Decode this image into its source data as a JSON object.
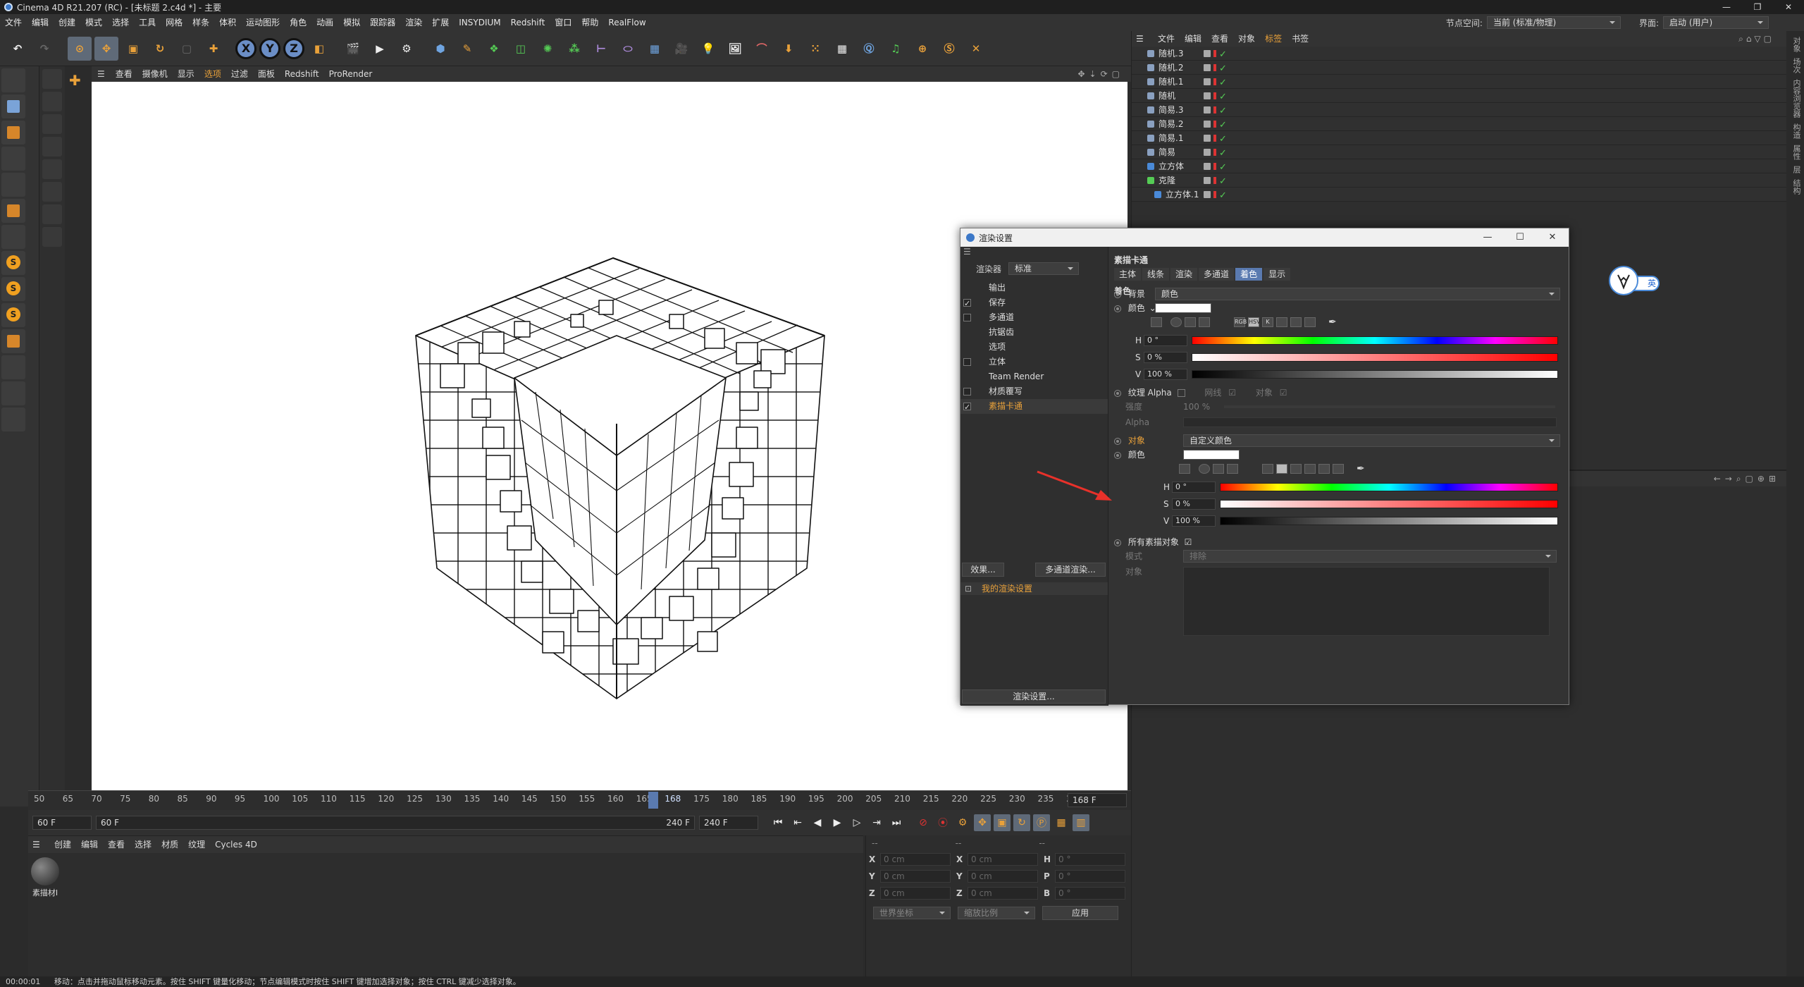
{
  "window": {
    "title": "Cinema 4D R21.207 (RC) - [未标题 2.c4d *] - 主要",
    "controls": [
      "—",
      "❐",
      "✕"
    ]
  },
  "menubar": {
    "items": [
      "文件",
      "编辑",
      "创建",
      "模式",
      "选择",
      "工具",
      "网格",
      "样条",
      "体积",
      "运动图形",
      "角色",
      "动画",
      "模拟",
      "跟踪器",
      "渲染",
      "扩展",
      "INSYDIUM",
      "Redshift",
      "窗口",
      "帮助",
      "RealFlow"
    ],
    "node_space_label": "节点空间:",
    "node_space_value": "当前 (标准/物理)",
    "layout_label": "界面:",
    "layout_value": "启动 (用户)"
  },
  "toolbar": {
    "axis_labels": [
      "X",
      "Y",
      "Z"
    ]
  },
  "viewport": {
    "menu": [
      "查看",
      "摄像机",
      "显示",
      "选项",
      "过滤",
      "面板",
      "Redshift",
      "ProRender"
    ],
    "active_menu": "选项"
  },
  "timeline": {
    "ticks": [
      "50",
      "65",
      "70",
      "75",
      "80",
      "85",
      "90",
      "95",
      "100",
      "105",
      "110",
      "115",
      "120",
      "125",
      "130",
      "135",
      "140",
      "145",
      "150",
      "155",
      "160",
      "165",
      "168",
      "175",
      "180",
      "185",
      "190",
      "195",
      "200",
      "205",
      "210",
      "215",
      "220",
      "225",
      "230",
      "235",
      "240"
    ],
    "current_frame": "168 F",
    "start_field": "60 F",
    "start_field2": "60 F",
    "end_field": "240 F",
    "end_field2": "240 F"
  },
  "material_panel": {
    "menu": [
      "创建",
      "编辑",
      "查看",
      "选择",
      "材质",
      "纹理",
      "Cycles 4D"
    ],
    "material_name": "素描材I"
  },
  "coords": {
    "header_left": "--",
    "header_mid": "--",
    "header_right": "--",
    "rows": [
      {
        "a": "X",
        "av": "0 cm",
        "b": "X",
        "bv": "0 cm",
        "c": "H",
        "cv": "0 °"
      },
      {
        "a": "Y",
        "av": "0 cm",
        "b": "Y",
        "bv": "0 cm",
        "c": "P",
        "cv": "0 °"
      },
      {
        "a": "Z",
        "av": "0 cm",
        "b": "Z",
        "bv": "0 cm",
        "c": "B",
        "cv": "0 °"
      }
    ],
    "world_coords": "世界坐标",
    "scale_ratio": "缩放比例",
    "apply": "应用"
  },
  "status": {
    "time": "00:00:01",
    "message": "移动：点击并拖动鼠标移动元素。按住 SHIFT 键量化移动；节点编辑模式时按住 SHIFT 键增加选择对象；按住 CTRL 键减少选择对象。"
  },
  "object_manager": {
    "menu": [
      "文件",
      "编辑",
      "查看",
      "对象",
      "标签",
      "书签"
    ],
    "active_menu": "标签",
    "objects": [
      {
        "name": "随机.3"
      },
      {
        "name": "随机.2"
      },
      {
        "name": "随机.1"
      },
      {
        "name": "随机"
      },
      {
        "name": "简易.3"
      },
      {
        "name": "简易.2"
      },
      {
        "name": "简易.1"
      },
      {
        "name": "简易"
      },
      {
        "name": "立方体"
      },
      {
        "name": "克隆"
      },
      {
        "name": "立方体.1"
      }
    ]
  },
  "right_strip": [
    "对象",
    "场次",
    "内容浏览器",
    "构造",
    "属性",
    "层",
    "结构"
  ],
  "render_dialog": {
    "title": "渲染设置",
    "renderer_label": "渲染器",
    "renderer_value": "标准",
    "items": [
      {
        "label": "输出",
        "check": "none"
      },
      {
        "label": "保存",
        "check": "on"
      },
      {
        "label": "多通道",
        "check": "off"
      },
      {
        "label": "抗锯齿",
        "check": "none"
      },
      {
        "label": "选项",
        "check": "none"
      },
      {
        "label": "立体",
        "check": "off"
      },
      {
        "label": "Team Render",
        "check": "none"
      },
      {
        "label": "材质覆写",
        "check": "off"
      },
      {
        "label": "素描卡通",
        "check": "on"
      }
    ],
    "effects_button": "效果...",
    "multipass_button": "多通道渲染...",
    "preset": "我的渲染设置",
    "render_settings_button": "渲染设置...",
    "section_title": "素描卡通",
    "tabs": [
      "主体",
      "线条",
      "渲染",
      "多通道",
      "着色",
      "显示"
    ],
    "active_tab": "着色",
    "shading_title": "着色",
    "background_label": "背景",
    "background_value": "颜色",
    "color_label": "颜色",
    "h_value": "0 °",
    "s_value": "0 %",
    "v_value": "100 %",
    "texture_alpha": "纹理 Alpha",
    "network": "网线",
    "object_chk": "对象",
    "strength_label": "强度",
    "strength_value": "100 %",
    "alpha_label": "Alpha",
    "object_label": "对象",
    "object_value": "自定义颜色",
    "color2_label": "颜色",
    "h2_value": "0 °",
    "s2_value": "0 %",
    "v2_value": "100 %",
    "all_sketch_objects": "所有素描对象",
    "mode_label": "模式",
    "mode_value": "排除",
    "objects_label": "对象",
    "color_tools": [
      "RGB",
      "HSV",
      "K"
    ]
  },
  "badge": {
    "label": "英"
  }
}
